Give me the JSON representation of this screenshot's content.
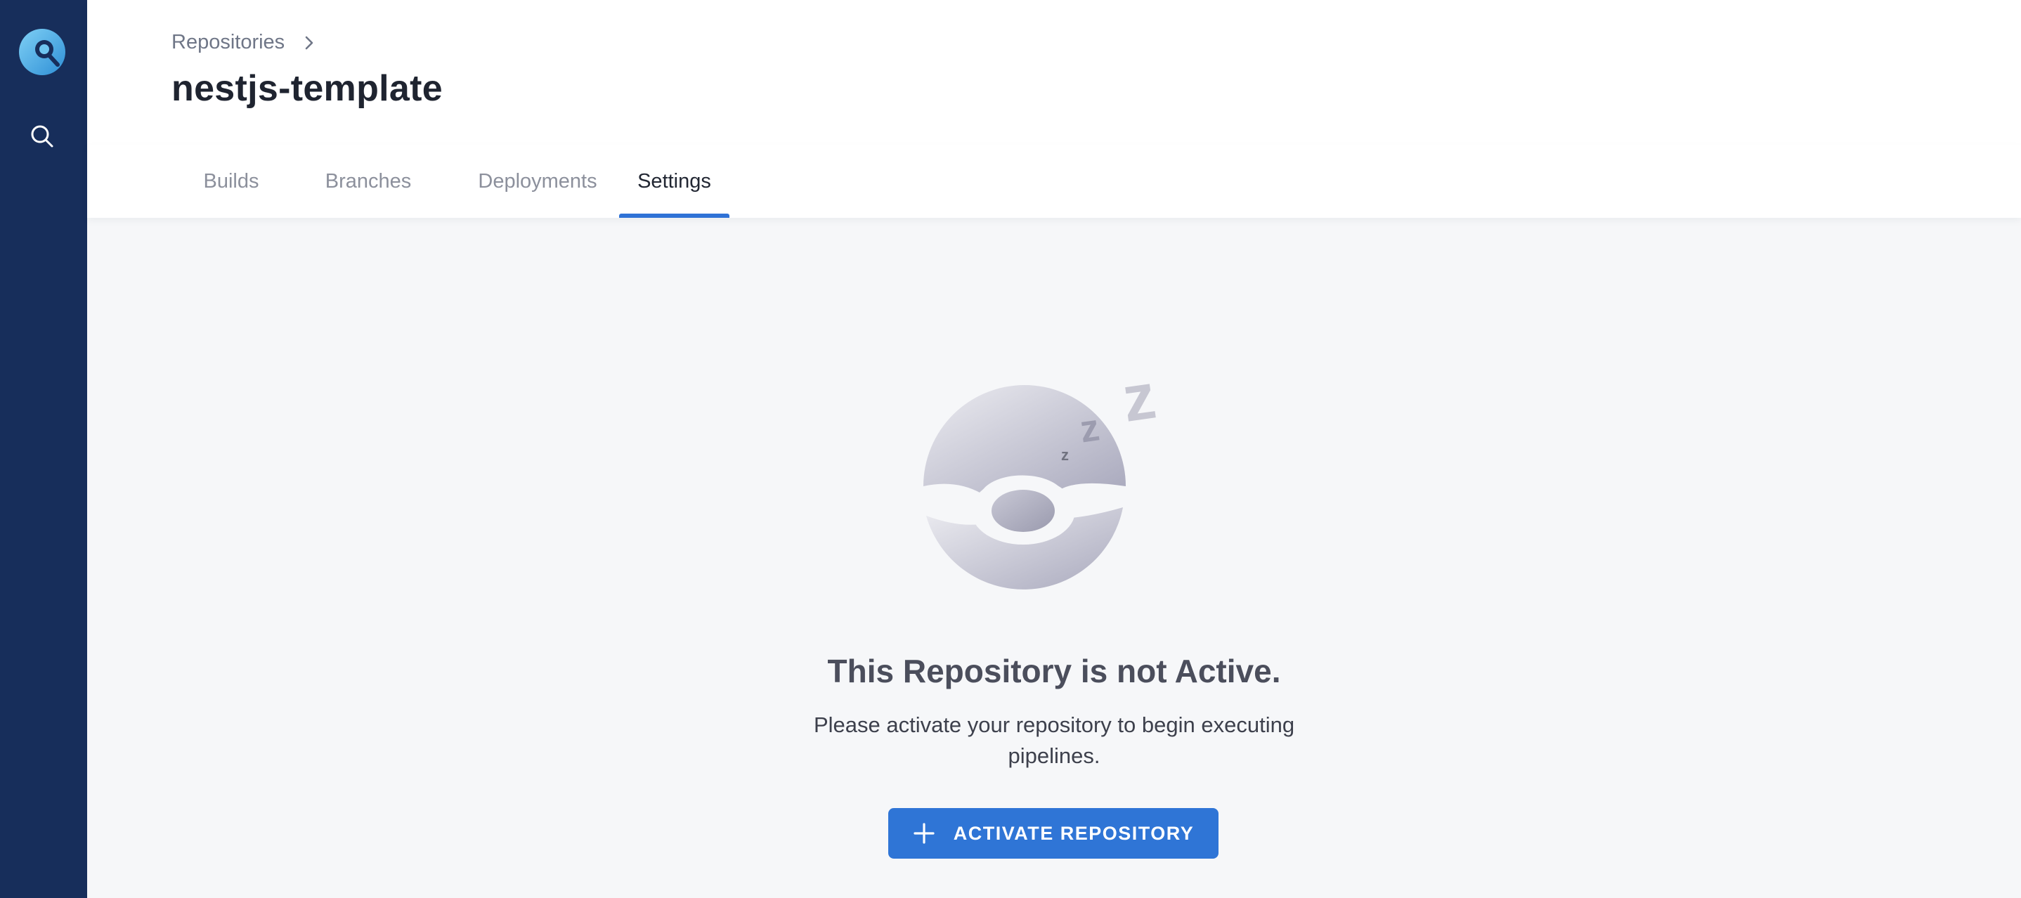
{
  "sidebar": {
    "logo_icon": "drone-logo-icon",
    "search_icon": "search-icon"
  },
  "header": {
    "breadcrumb": {
      "label": "Repositories",
      "separator_icon": "chevron-right-icon"
    },
    "title": "nestjs-template"
  },
  "tabs": [
    {
      "label": "Builds",
      "active": false
    },
    {
      "label": "Branches",
      "active": false
    },
    {
      "label": "Deployments",
      "active": false
    },
    {
      "label": "Settings",
      "active": true
    }
  ],
  "empty_state": {
    "illustration_icon": "sleeping-repository-icon",
    "title": "This Repository is not Active.",
    "description": "Please activate your repository to begin executing pipelines.",
    "button": {
      "label": "ACTIVATE REPOSITORY",
      "icon": "plus-icon"
    }
  },
  "colors": {
    "sidebar": "#172e5b",
    "accent": "#2f75d6",
    "background": "#f6f7f9"
  }
}
